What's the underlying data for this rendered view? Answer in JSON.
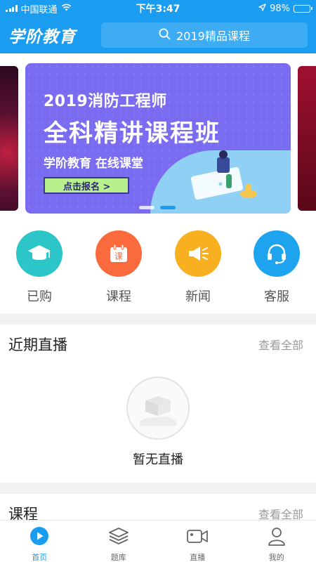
{
  "status_bar": {
    "carrier": "中国联通",
    "time": "下午3:47",
    "battery": "98%",
    "battery_level": 0.98
  },
  "header": {
    "app_name": "学阶教育",
    "search_placeholder": "2019精品课程"
  },
  "banner": {
    "title_line1": "2019消防工程师",
    "title_line2": "全科精讲课程班",
    "subtitle": "学阶教育 在线课堂",
    "cta": "点击报名 >",
    "pages": 2,
    "active_page": 2
  },
  "quick_menu": [
    {
      "label": "已购",
      "icon": "graduation-cap-icon",
      "color": "#2cc6c8"
    },
    {
      "label": "课程",
      "icon": "course-calendar-icon",
      "glyph": "课",
      "color": "#fb6a3c"
    },
    {
      "label": "新闻",
      "icon": "megaphone-icon",
      "color": "#f9b020"
    },
    {
      "label": "客服",
      "icon": "headset-icon",
      "color": "#1ea4ee"
    }
  ],
  "live_section": {
    "title": "近期直播",
    "more": "查看全部",
    "empty_text": "暂无直播"
  },
  "course_section": {
    "title": "课程",
    "more": "查看全部"
  },
  "tabbar": [
    {
      "label": "首页",
      "icon": "home-play-icon",
      "active": true
    },
    {
      "label": "题库",
      "icon": "layers-icon",
      "active": false
    },
    {
      "label": "直播",
      "icon": "video-camera-icon",
      "active": false
    },
    {
      "label": "我的",
      "icon": "user-icon",
      "active": false
    }
  ],
  "colors": {
    "primary": "#1a9cf0",
    "banner_bg": "#7a6cf0"
  }
}
